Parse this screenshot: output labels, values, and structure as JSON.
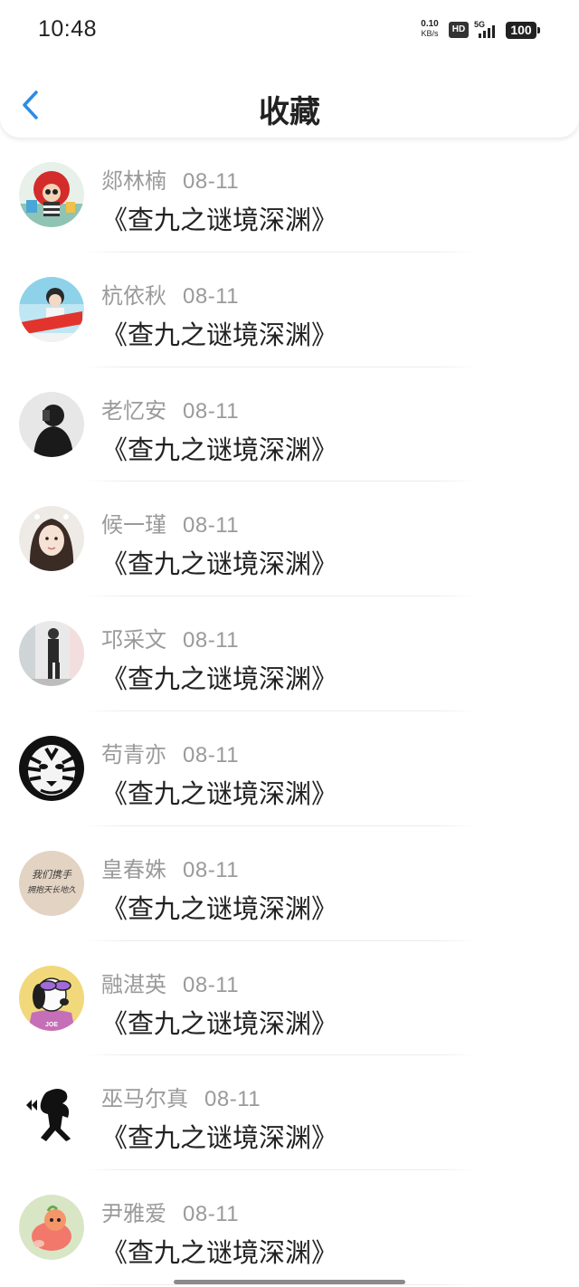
{
  "status_bar": {
    "time": "10:48",
    "net_speed_value": "0.10",
    "net_speed_unit": "KB/s",
    "hd_label": "HD",
    "network_type": "5G",
    "battery": "100"
  },
  "header": {
    "title": "收藏",
    "back_icon": "chevron-left-icon",
    "accent_color": "#2b8ce6"
  },
  "favorites": [
    {
      "user": "郯林楠",
      "date": "08-11",
      "title": "《查九之谜境深渊》",
      "avatar": "avatar-red-doll"
    },
    {
      "user": "杭依秋",
      "date": "08-11",
      "title": "《查九之谜境深渊》",
      "avatar": "avatar-girl-banner"
    },
    {
      "user": "老忆安",
      "date": "08-11",
      "title": "《查九之谜境深渊》",
      "avatar": "avatar-dark-figure"
    },
    {
      "user": "候一瑾",
      "date": "08-11",
      "title": "《查九之谜境深渊》",
      "avatar": "avatar-girl-portrait"
    },
    {
      "user": "邛采文",
      "date": "08-11",
      "title": "《查九之谜境深渊》",
      "avatar": "avatar-standing-man"
    },
    {
      "user": "苟青亦",
      "date": "08-11",
      "title": "《查九之谜境深渊》",
      "avatar": "avatar-tiger"
    },
    {
      "user": "皇春姝",
      "date": "08-11",
      "title": "《查九之谜境深渊》",
      "avatar": "avatar-handwriting"
    },
    {
      "user": "融湛英",
      "date": "08-11",
      "title": "《查九之谜境深渊》",
      "avatar": "avatar-snoopy"
    },
    {
      "user": "巫马尔真",
      "date": "08-11",
      "title": "《查九之谜境深渊》",
      "avatar": "avatar-silhouette-girl"
    },
    {
      "user": "尹雅爱",
      "date": "08-11",
      "title": "《查九之谜境深渊》",
      "avatar": "avatar-cartoon-fish"
    }
  ],
  "avatar_handwriting_text": [
    "我们携手",
    "拥抱天长地久"
  ],
  "avatar_snoopy_text": "JOE"
}
